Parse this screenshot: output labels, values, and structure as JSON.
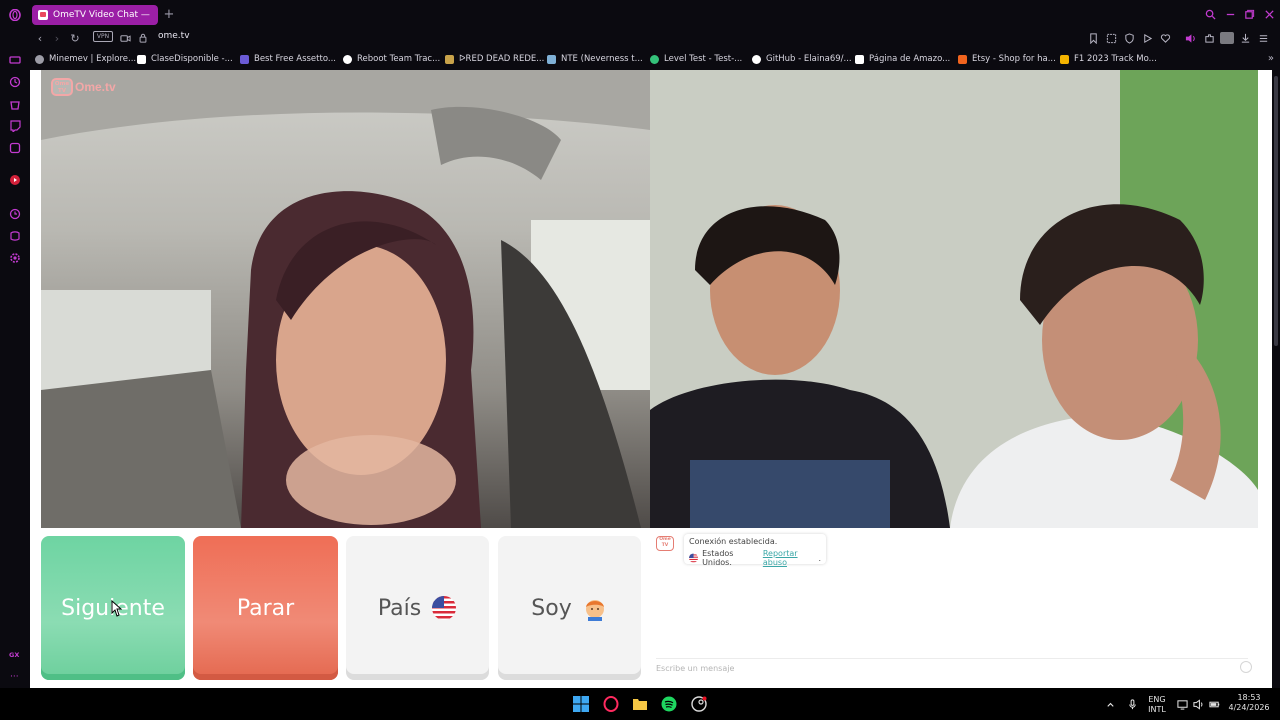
{
  "browser": {
    "tab_title": "OmeTV Video Chat — ",
    "url": "ome.tv",
    "vpn_label": "VPN",
    "new_tab": "+",
    "sidebar_badge": "GX"
  },
  "bookmarks": [
    {
      "label": "Minemev | Explore...",
      "color": "#9c9ca6"
    },
    {
      "label": "ClaseDisponible -...",
      "color": "#ffffff"
    },
    {
      "label": "Best Free Assetto...",
      "color": "#6b5bd6"
    },
    {
      "label": "Reboot Team Trac...",
      "color": "#ffffff"
    },
    {
      "label": "ᐅRED DEAD REDE...",
      "color": "#c9a34a"
    },
    {
      "label": "NTE (Neverness t...",
      "color": "#7fb0d6"
    },
    {
      "label": "Level Test - Test-...",
      "color": "#34c27a"
    },
    {
      "label": "GitHub - Elaina69/...",
      "color": "#ffffff"
    },
    {
      "label": "Página de Amazo...",
      "color": "#ffffff"
    },
    {
      "label": "Etsy - Shop for ha...",
      "color": "#f1641e"
    },
    {
      "label": "F1 2023 Track Mo...",
      "color": "#f4b400"
    }
  ],
  "logo": {
    "text": "Ome.tv",
    "badge": "Ome TV"
  },
  "controls": {
    "next_label": "Siguiente",
    "stop_label": "Parar",
    "country_label": "País",
    "me_label": "Soy"
  },
  "chat": {
    "status": "Conexión establecida.",
    "country": "Estados Unidos.",
    "report_link": "Reportar abuso",
    "report_suffix": ".",
    "input_placeholder": "Escribe un mensaje"
  },
  "taskbar": {
    "lang_top": "ENG",
    "lang_bottom": "INTL",
    "time": "18:53",
    "date": "4/24/2026"
  },
  "colors": {
    "accent": "#9b1fa6",
    "next_green": "#6ed4a2",
    "stop_red": "#ef6e56",
    "link_teal": "#3aa7a7"
  }
}
